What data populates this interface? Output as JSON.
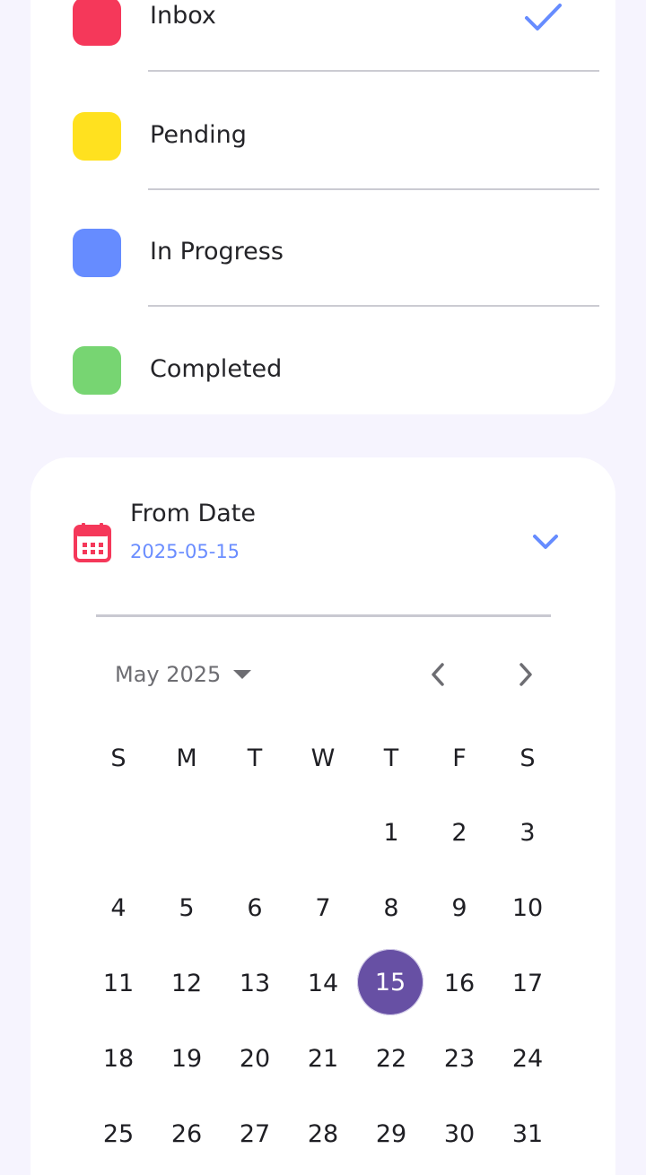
{
  "statuses": [
    {
      "label": "Inbox",
      "color": "#f5385a",
      "selected": true
    },
    {
      "label": "Pending",
      "color": "#ffe11f",
      "selected": false
    },
    {
      "label": "In Progress",
      "color": "#668cff",
      "selected": false
    },
    {
      "label": "Completed",
      "color": "#77d572",
      "selected": false
    }
  ],
  "date_picker": {
    "title": "From Date",
    "value": "2025-05-15",
    "month_label": "May 2025",
    "weekdays": [
      "S",
      "M",
      "T",
      "W",
      "T",
      "F",
      "S"
    ],
    "weeks": [
      [
        "",
        "",
        "",
        "",
        "1",
        "2",
        "3"
      ],
      [
        "4",
        "5",
        "6",
        "7",
        "8",
        "9",
        "10"
      ],
      [
        "11",
        "12",
        "13",
        "14",
        "15",
        "16",
        "17"
      ],
      [
        "18",
        "19",
        "20",
        "21",
        "22",
        "23",
        "24"
      ],
      [
        "25",
        "26",
        "27",
        "28",
        "29",
        "30",
        "31"
      ]
    ],
    "selected_day": "15"
  },
  "colors": {
    "background": "#f6f4fe",
    "accent": "#668cff",
    "selected_day": "#6750a4",
    "calendar_icon": "#f5385a"
  },
  "icons": {
    "check": "check-icon",
    "calendar": "calendar-icon",
    "expand": "chevron-down-icon",
    "month_menu": "caret-down-icon",
    "previous": "chevron-left-icon",
    "next": "chevron-right-icon"
  }
}
